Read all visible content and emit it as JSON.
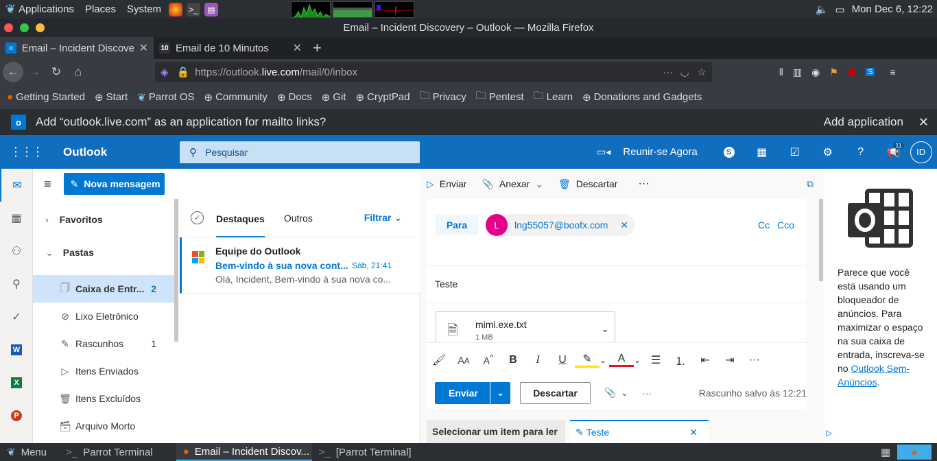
{
  "system_bar": {
    "applications": "Applications",
    "places": "Places",
    "system": "System",
    "clock": "Mon Dec  6, 12:22"
  },
  "window": {
    "title": "Email – Incident Discovery – Outlook — Mozilla Firefox"
  },
  "tabs": [
    {
      "label": "Email – Incident Discove"
    },
    {
      "label": "Email de 10 Minutos"
    }
  ],
  "urlbar": {
    "url_prefix": "https://outlook.",
    "url_domain": "live.com",
    "url_path": "/mail/0/inbox"
  },
  "bookmarks": [
    {
      "label": "Getting Started"
    },
    {
      "label": "Start"
    },
    {
      "label": "Parrot OS"
    },
    {
      "label": "Community"
    },
    {
      "label": "Docs"
    },
    {
      "label": "Git"
    },
    {
      "label": "CryptPad"
    },
    {
      "label": "Privacy"
    },
    {
      "label": "Pentest"
    },
    {
      "label": "Learn"
    },
    {
      "label": "Donations and Gadgets"
    }
  ],
  "notification": {
    "text": "Add “outlook.live.com” as an application for mailto links?",
    "action": "Add application"
  },
  "outlook_header": {
    "app_name": "Outlook",
    "search_placeholder": "Pesquisar",
    "meet_now": "Reunir-se Agora",
    "notif_count": "11",
    "avatar": "ID"
  },
  "folders": {
    "new_message": "Nova mensagem",
    "favorites": "Favoritos",
    "folders": "Pastas",
    "items": [
      {
        "label": "Caixa de Entr...",
        "count": "2"
      },
      {
        "label": "Lixo Eletrônico",
        "count": ""
      },
      {
        "label": "Rascunhos",
        "count": "1"
      },
      {
        "label": "Itens Enviados",
        "count": ""
      },
      {
        "label": "Itens Excluídos",
        "count": ""
      },
      {
        "label": "Arquivo Morto",
        "count": ""
      }
    ]
  },
  "message_list": {
    "tab_focused": "Destaques",
    "tab_other": "Outros",
    "filter": "Filtrar",
    "messages": [
      {
        "sender": "Equipe do Outlook",
        "subject": "Bem-vindo à sua nova cont...",
        "time": "Sáb, 21:41",
        "preview": "Olá, Incident, Bem-vindo à sua nova co..."
      }
    ]
  },
  "compose": {
    "toolbar_send": "Enviar",
    "toolbar_attach": "Anexar",
    "toolbar_discard": "Descartar",
    "to_label": "Para",
    "recipient_initial": "L",
    "recipient": "lng55057@boofx.com",
    "cc": "Cc",
    "bcc": "Cco",
    "subject": "Teste",
    "attachment_name": "mimi.exe.txt",
    "attachment_size": "1 MB",
    "send_button": "Enviar",
    "discard_button": "Descartar",
    "draft_status": "Rascunho salvo às 12:21",
    "bottom_tab_select": "Selecionar um item para ler",
    "bottom_tab_draft": "Teste"
  },
  "ad_pane": {
    "text": "Parece que você está usando um bloqueador de anúncios. Para maximizar o espaço na sua caixa de entrada, inscreva-se no",
    "link": "Outlook Sem-Anúncios",
    "end": "."
  },
  "taskbar": {
    "menu": "Menu",
    "items": [
      {
        "label": "Parrot Terminal"
      },
      {
        "label": "Email – Incident Discov..."
      },
      {
        "label": "[Parrot Terminal]"
      }
    ]
  },
  "colors": {
    "outlook_blue": "#106ebe",
    "accent": "#0078d4"
  }
}
